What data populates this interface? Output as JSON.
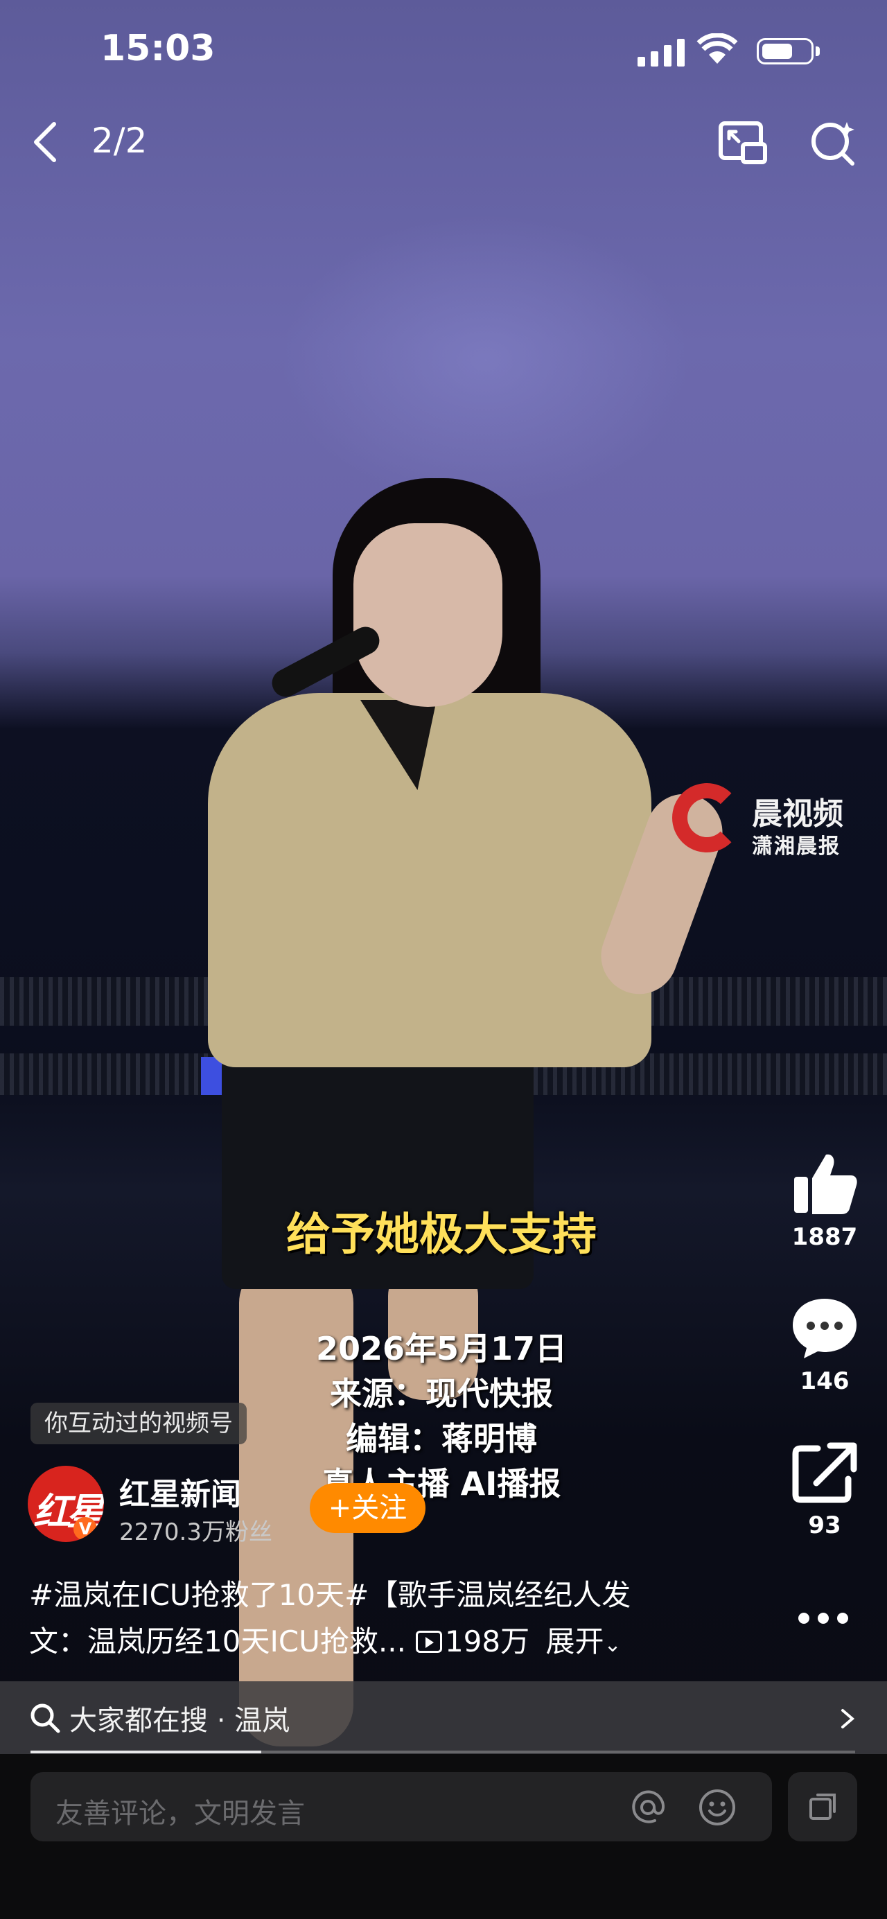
{
  "status_bar": {
    "time": "15:03",
    "battery_level": 0.65
  },
  "nav": {
    "page_indicator": "2/2",
    "back_icon": "chevron-left-icon",
    "pip_icon": "picture-in-picture-icon",
    "search_icon": "search-icon"
  },
  "video": {
    "watermark": {
      "line1": "晨视频",
      "line2": "潇湘晨报"
    },
    "caption_main": "给予她极大支持",
    "caption_date": "2026年5月17日",
    "caption_source": "来源：现代快报",
    "caption_editor": "编辑：蒋明博",
    "caption_anchor": "真人主播 AI播报"
  },
  "author": {
    "interaction_tag": "你互动过的视频号",
    "avatar_text": "红星",
    "avatar_badge": "V",
    "name": "红星新闻",
    "followers": "2270.3万粉丝",
    "follow_label": "+关注"
  },
  "description": {
    "line1": "#温岚在ICU抢救了10天#【歌手温岚经纪人发",
    "line2": "文：温岚历经10天ICU抢救...",
    "views": "198万",
    "expand_label": "展开"
  },
  "actions": {
    "likes": "1887",
    "comments": "146",
    "shares": "93",
    "icons": [
      "thumbs-up-icon",
      "comment-icon",
      "share-icon",
      "more-icon"
    ]
  },
  "search_bar": {
    "text": "大家都在搜 · 温岚"
  },
  "playback": {
    "progress": 0.28
  },
  "comment_bar": {
    "placeholder": "友善评论，文明发言"
  },
  "colors": {
    "follow": "#ff8a00",
    "caption": "#ffe05a",
    "brand_red": "#d42a2a"
  }
}
